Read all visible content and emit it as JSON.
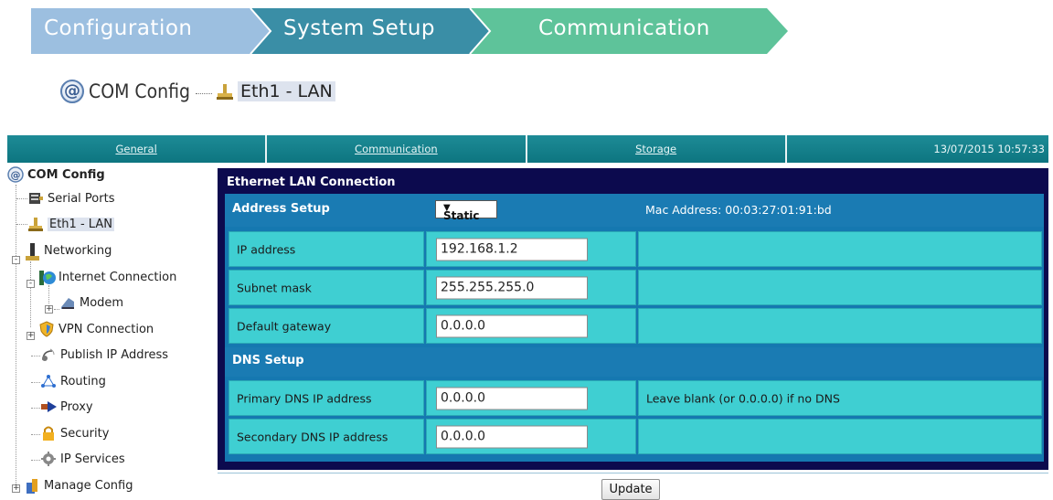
{
  "breadcrumb": {
    "steps": [
      "Configuration",
      "System Setup",
      "Communication"
    ],
    "colors": [
      "#9cbfe0",
      "#3a8ea6",
      "#5ec39a"
    ]
  },
  "title": {
    "root": "COM Config",
    "selected": "Eth1 - LAN"
  },
  "tabs": [
    "General",
    "Communication",
    "Storage",
    "13/07/2015 10:57:33"
  ],
  "sidebar": {
    "root": "COM Config",
    "items": [
      {
        "label": "Serial Ports",
        "icon": "serial-port-icon"
      },
      {
        "label": "Eth1 - LAN",
        "icon": "ethernet-icon"
      },
      {
        "label": "Networking",
        "icon": "networking-icon"
      },
      {
        "label": "Internet Connection",
        "icon": "globe-icon"
      },
      {
        "label": "Modem",
        "icon": "modem-icon"
      },
      {
        "label": "VPN Connection",
        "icon": "shield-icon"
      },
      {
        "label": "Publish IP Address",
        "icon": "satellite-icon"
      },
      {
        "label": "Routing",
        "icon": "routing-icon"
      },
      {
        "label": "Proxy",
        "icon": "proxy-icon"
      },
      {
        "label": "Security",
        "icon": "lock-icon"
      },
      {
        "label": "IP Services",
        "icon": "gear-icon"
      },
      {
        "label": "Manage Config",
        "icon": "manage-config-icon"
      }
    ]
  },
  "panel": {
    "header": "Ethernet LAN Connection",
    "address_setup": {
      "title": "Address Setup",
      "mode": "Static",
      "mac": "Mac Address: 00:03:27:01:91:bd"
    },
    "fields": [
      {
        "label": "IP address",
        "value": "192.168.1.2",
        "note": ""
      },
      {
        "label": "Subnet mask",
        "value": "255.255.255.0",
        "note": ""
      },
      {
        "label": "Default gateway",
        "value": "0.0.0.0",
        "note": ""
      }
    ],
    "dns": {
      "title": "DNS Setup",
      "fields": [
        {
          "label": "Primary DNS IP address",
          "value": "0.0.0.0",
          "note": "Leave blank (or 0.0.0.0) if no DNS"
        },
        {
          "label": "Secondary DNS IP address",
          "value": "0.0.0.0",
          "note": ""
        }
      ]
    },
    "update_label": "Update"
  }
}
